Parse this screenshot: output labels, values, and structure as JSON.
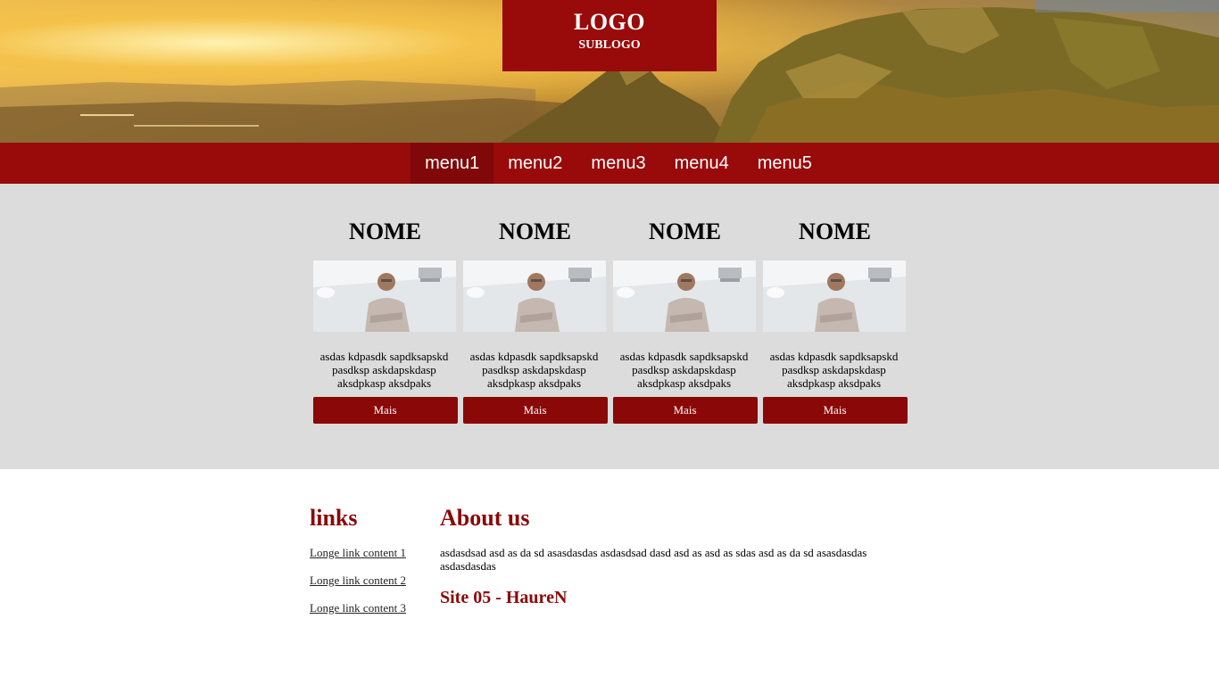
{
  "header": {
    "logo": "LOGO",
    "sublogo": "SUBLOGO"
  },
  "nav": {
    "items": [
      "menu1",
      "menu2",
      "menu3",
      "menu4",
      "menu5"
    ],
    "active": "menu1"
  },
  "cards": [
    {
      "title": "NOME",
      "description": "asdas kdpasdk sapdksapskd pasdksp askdapskdasp aksdpkasp aksdpaks",
      "button": "Mais"
    },
    {
      "title": "NOME",
      "description": "asdas kdpasdk sapdksapskd pasdksp askdapskdasp aksdpkasp aksdpaks",
      "button": "Mais"
    },
    {
      "title": "NOME",
      "description": "asdas kdpasdk sapdksapskd pasdksp askdapskdasp aksdpkasp aksdpaks",
      "button": "Mais"
    },
    {
      "title": "NOME",
      "description": "asdas kdpasdk sapdksapskd pasdksp askdapskdasp aksdpkasp aksdpaks",
      "button": "Mais"
    }
  ],
  "footer": {
    "links_title": "links",
    "links": [
      "Longe link content 1",
      "Longe link content 2",
      "Longe link content 3"
    ],
    "about_title": "About us",
    "about_text": "asdasdsad asd as da sd asasdasdas asdasdsad dasd asd as asd as sdas asd as da sd asasdasdas asdasdasdas",
    "site_title": "Site 05 - HaureN"
  },
  "colors": {
    "brand": "#990a0a",
    "brand_dark": "#800808",
    "button": "#8b0808",
    "cards_bg": "#dcdcdc"
  }
}
